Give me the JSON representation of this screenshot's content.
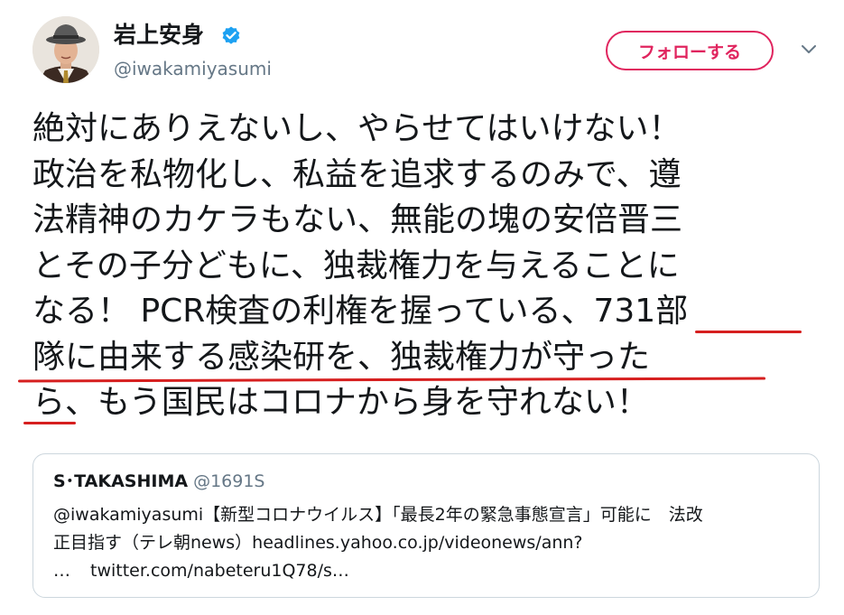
{
  "author": {
    "display_name": "岩上安身",
    "handle": "@iwakamiyasumi",
    "verified": true,
    "avatar": "avatar-photo"
  },
  "header": {
    "follow_label": "フォローする",
    "more_icon": "chevron-down-icon"
  },
  "tweet": {
    "lines": [
      "絶対にありえないし、やらせてはいけない！",
      "政治を私物化し、私益を追求するのみで、遵",
      "法精神のカケラもない、無能の塊の安倍晋三",
      "とその子分どもに、独裁権力を与えることに",
      "なる！ PCR検査の利権を握っている、731部",
      "隊に由来する感染研を、独裁権力が守った",
      "ら、もう国民はコロナから身を守れない！"
    ],
    "annotation_color": "#d61f1f"
  },
  "quote": {
    "name": "S･TAKASHIMA",
    "handle": "@1691S",
    "lines": [
      "@iwakamiyasumi【新型コロナウイルス】「最長2年の緊急事態宣言」可能に　法改",
      "正目指す（テレ朝news）headlines.yahoo.co.jp/videonews/ann?"
    ],
    "ellipsis": "…",
    "link": "twitter.com/nabeteru1Q78/s…"
  },
  "colors": {
    "follow_accent": "#e0245e",
    "verified_blue": "#1da1f2",
    "secondary_text": "#657786",
    "border": "#ccd6dd"
  }
}
